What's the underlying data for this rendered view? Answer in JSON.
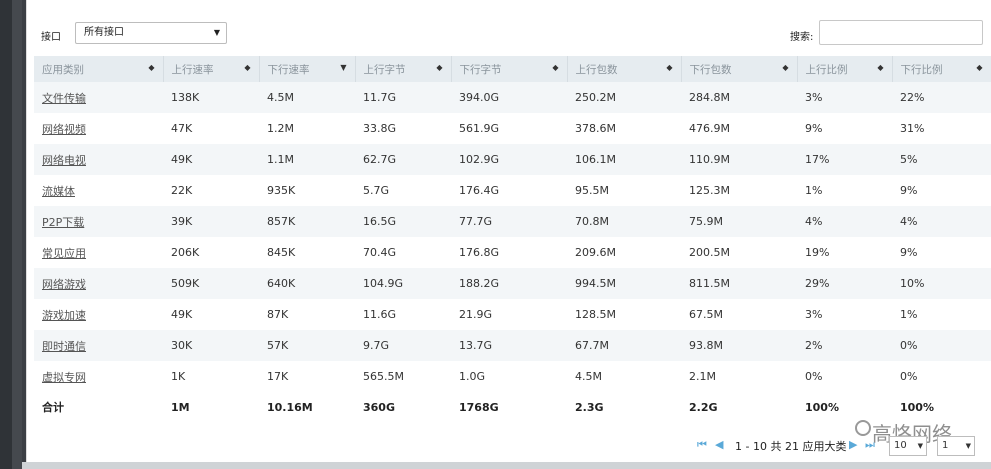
{
  "filter": {
    "label": "接口",
    "selected": "所有接口"
  },
  "search": {
    "label": "搜索:",
    "value": ""
  },
  "table": {
    "headers": [
      "应用类别",
      "上行速率",
      "下行速率",
      "上行字节",
      "下行字节",
      "上行包数",
      "下行包数",
      "上行比例",
      "下行比例"
    ],
    "rows": [
      [
        "文件传输",
        "138K",
        "4.5M",
        "11.7G",
        "394.0G",
        "250.2M",
        "284.8M",
        "3%",
        "22%"
      ],
      [
        "网络视频",
        "47K",
        "1.2M",
        "33.8G",
        "561.9G",
        "378.6M",
        "476.9M",
        "9%",
        "31%"
      ],
      [
        "网络电视",
        "49K",
        "1.1M",
        "62.7G",
        "102.9G",
        "106.1M",
        "110.9M",
        "17%",
        "5%"
      ],
      [
        "流媒体",
        "22K",
        "935K",
        "5.7G",
        "176.4G",
        "95.5M",
        "125.3M",
        "1%",
        "9%"
      ],
      [
        "P2P下载",
        "39K",
        "857K",
        "16.5G",
        "77.7G",
        "70.8M",
        "75.9M",
        "4%",
        "4%"
      ],
      [
        "常见应用",
        "206K",
        "845K",
        "70.4G",
        "176.8G",
        "209.6M",
        "200.5M",
        "19%",
        "9%"
      ],
      [
        "网络游戏",
        "509K",
        "640K",
        "104.9G",
        "188.2G",
        "994.5M",
        "811.5M",
        "29%",
        "10%"
      ],
      [
        "游戏加速",
        "49K",
        "87K",
        "11.6G",
        "21.9G",
        "128.5M",
        "67.5M",
        "3%",
        "1%"
      ],
      [
        "即时通信",
        "30K",
        "57K",
        "9.7G",
        "13.7G",
        "67.7M",
        "93.8M",
        "2%",
        "0%"
      ],
      [
        "虚拟专网",
        "1K",
        "17K",
        "565.5M",
        "1.0G",
        "4.5M",
        "2.1M",
        "0%",
        "0%"
      ]
    ],
    "total": [
      "合计",
      "1M",
      "10.16M",
      "360G",
      "1768G",
      "2.3G",
      "2.2G",
      "100%",
      "100%"
    ]
  },
  "pager": {
    "range_text": "1 - 10 共 21 应用大类",
    "page_size": "10",
    "page": "1"
  },
  "watermark": "高恪网络"
}
